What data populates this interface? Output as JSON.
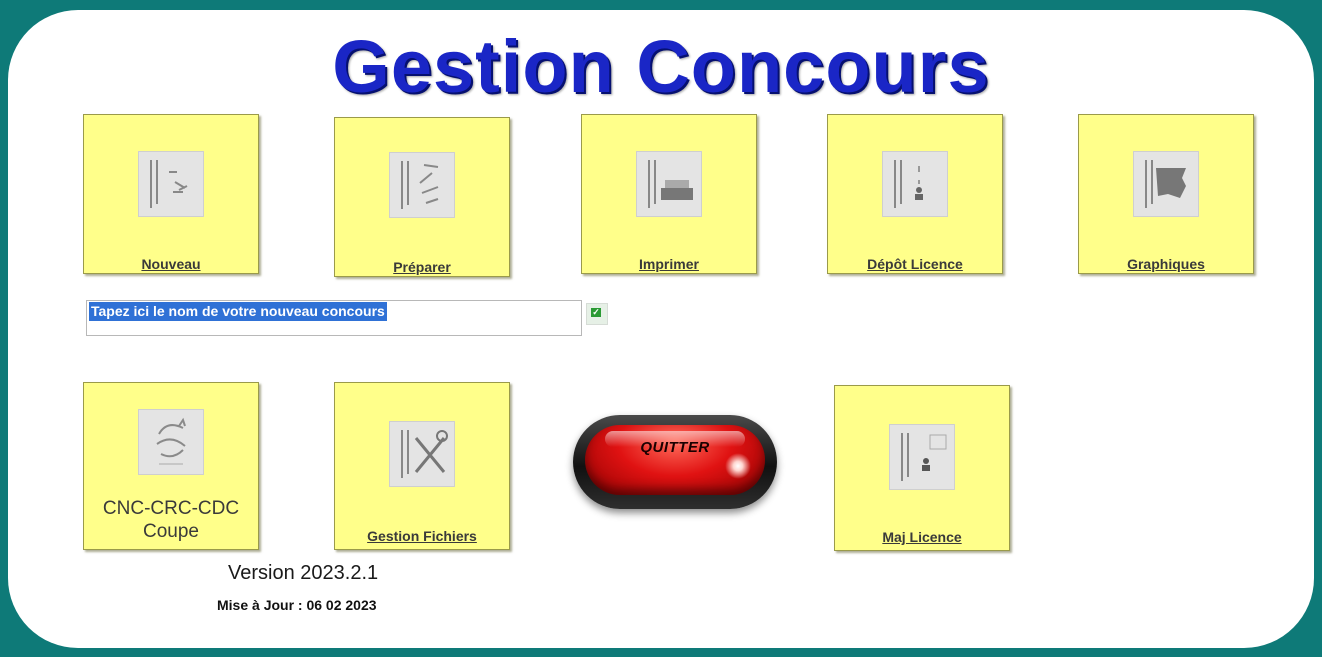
{
  "app": {
    "title": "Gestion Concours"
  },
  "tiles": {
    "nouveau": {
      "label": "Nouveau",
      "icon": "new-competition-icon"
    },
    "preparer": {
      "label": "Préparer",
      "icon": "prepare-icon"
    },
    "imprimer": {
      "label": "Imprimer",
      "icon": "printer-icon"
    },
    "depot_licence": {
      "label": "Dépôt Licence",
      "icon": "license-upload-icon"
    },
    "graphiques": {
      "label": "Graphiques",
      "icon": "charts-icon"
    },
    "cnc": {
      "label_line1": "CNC-CRC-CDC",
      "label_line2": "Coupe",
      "icon": "rooster-icon"
    },
    "gestion_fichiers": {
      "label": "Gestion Fichiers",
      "icon": "tools-icon"
    },
    "maj_licence": {
      "label": "Maj Licence",
      "icon": "license-update-icon"
    }
  },
  "new_competition": {
    "value": "Tapez ici le nom de votre nouveau concours",
    "validate_icon": "check-icon"
  },
  "quit": {
    "label": "QUITTER"
  },
  "footer": {
    "version": "Version 2023.2.1",
    "update": "Mise à Jour : 06 02 2023"
  },
  "colors": {
    "background": "#0e7a78",
    "panel": "#ffffff",
    "title": "#1a26c6",
    "tile": "#ffff8a",
    "quit_button": "#e01212",
    "selection": "#2f71d6"
  }
}
